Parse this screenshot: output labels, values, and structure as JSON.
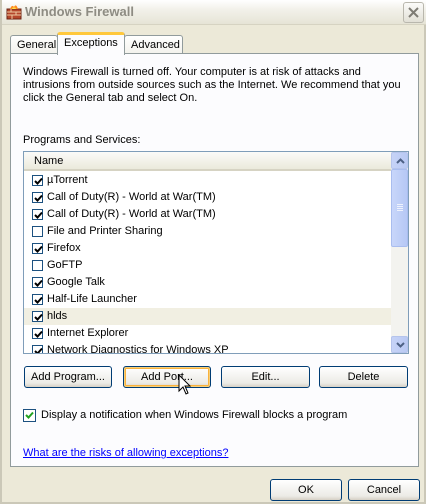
{
  "window": {
    "title": "Windows Firewall",
    "close_symbol": "✕"
  },
  "tabs": [
    {
      "label": "General",
      "active": false
    },
    {
      "label": "Exceptions",
      "active": true
    },
    {
      "label": "Advanced",
      "active": false
    }
  ],
  "info_text": "Windows Firewall is turned off. Your computer is at risk of attacks and intrusions from outside sources such as the Internet. We recommend that you click the General tab and select On.",
  "programs_label": "Programs and Services:",
  "list": {
    "column_header": "Name",
    "rows": [
      {
        "label": "µTorrent",
        "checked": true
      },
      {
        "label": "Call of Duty(R) - World at War(TM)",
        "checked": true
      },
      {
        "label": "Call of Duty(R) - World at War(TM)",
        "checked": true
      },
      {
        "label": "File and Printer Sharing",
        "checked": false
      },
      {
        "label": "Firefox",
        "checked": true
      },
      {
        "label": "GoFTP",
        "checked": false
      },
      {
        "label": "Google Talk",
        "checked": true
      },
      {
        "label": "Half-Life Launcher",
        "checked": true
      },
      {
        "label": "hlds",
        "checked": true,
        "highlighted": true
      },
      {
        "label": "Internet Explorer",
        "checked": true
      },
      {
        "label": "Network Diagnostics for Windows XP",
        "checked": true
      }
    ]
  },
  "buttons": {
    "add_program": "Add Program...",
    "add_port": "Add Port...",
    "edit": "Edit...",
    "delete": "Delete",
    "ok": "OK",
    "cancel": "Cancel"
  },
  "notify": {
    "label": "Display a notification when Windows Firewall blocks a program",
    "checked": true
  },
  "help_link": "What are the risks of allowing exceptions?",
  "colors": {
    "accent_tab": "#ffc83c",
    "link": "#0000ff",
    "check": "#21a121"
  }
}
